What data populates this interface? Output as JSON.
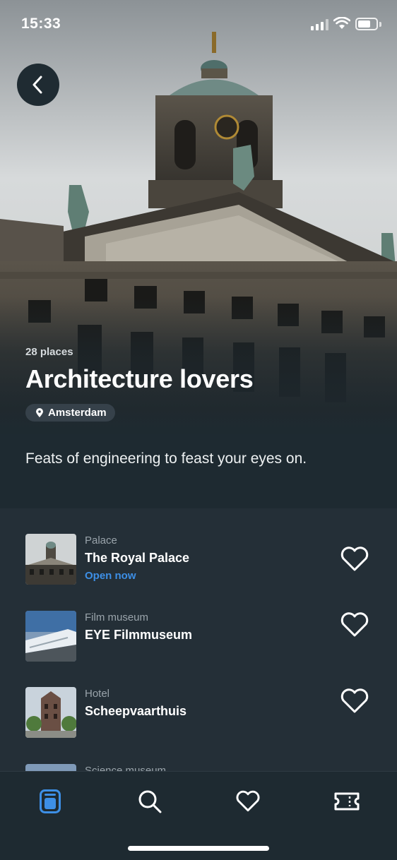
{
  "status_bar": {
    "time": "15:33"
  },
  "hero": {
    "places_count": "28 places",
    "title": "Architecture lovers",
    "city": "Amsterdam",
    "description": "Feats of engineering to feast your eyes on."
  },
  "icons": {
    "back": "chevron-left-icon",
    "location": "location-pin-icon",
    "favorite": "heart-icon"
  },
  "places": [
    {
      "category": "Palace",
      "name": "The Royal Palace",
      "status": "Open now"
    },
    {
      "category": "Film museum",
      "name": "EYE Filmmuseum",
      "status": ""
    },
    {
      "category": "Hotel",
      "name": "Scheepvaarthuis",
      "status": ""
    },
    {
      "category": "Science museum",
      "name": "",
      "status": ""
    }
  ],
  "tabs": [
    {
      "name": "collections",
      "icon": "collections-icon",
      "active": true
    },
    {
      "name": "search",
      "icon": "search-icon",
      "active": false
    },
    {
      "name": "favorites",
      "icon": "heart-icon",
      "active": false
    },
    {
      "name": "tickets",
      "icon": "ticket-icon",
      "active": false
    }
  ],
  "colors": {
    "background": "#1e2a31",
    "list_background": "#242f37",
    "accent": "#3d8fe6",
    "muted_text": "#9aa4ab"
  }
}
